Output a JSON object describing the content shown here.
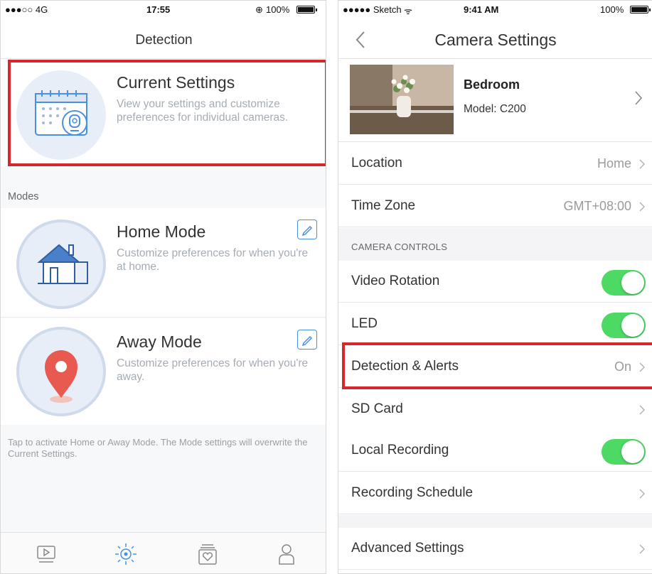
{
  "left": {
    "status": {
      "carrier": "●●●○○ 4G",
      "time": "17:55",
      "battery_label": "100%",
      "battery_level": 1.0
    },
    "title": "Detection",
    "current_settings": {
      "title": "Current Settings",
      "description": "View your settings and customize preferences for individual cameras."
    },
    "modes_label": "Modes",
    "home_mode": {
      "title": "Home Mode",
      "description": "Customize preferences for when you're at home."
    },
    "away_mode": {
      "title": "Away Mode",
      "description": "Customize preferences for when you're away."
    },
    "footer_note": "Tap to activate Home or Away Mode. The Mode settings will overwrite the Current Settings.",
    "tabs": [
      {
        "icon": "video-playback-icon"
      },
      {
        "icon": "detection-icon",
        "active": true
      },
      {
        "icon": "memories-icon"
      },
      {
        "icon": "profile-icon"
      }
    ],
    "colors": {
      "accent": "#4a90e2",
      "highlight": "#d7262c",
      "pin": "#e8594f"
    }
  },
  "right": {
    "status": {
      "carrier": "●●●●● Sketch",
      "time": "9:41 AM",
      "battery_label": "100%",
      "battery_level": 1.0
    },
    "title": "Camera Settings",
    "camera": {
      "name": "Bedroom",
      "model": "Model: C200"
    },
    "rows_top": [
      {
        "label": "Location",
        "value": "Home"
      },
      {
        "label": "Time Zone",
        "value": "GMT+08:00"
      }
    ],
    "section_label": "CAMERA CONTROLS",
    "controls": [
      {
        "label": "Video Rotation",
        "toggle": true
      },
      {
        "label": "LED",
        "toggle": true
      },
      {
        "label": "Detection & Alerts",
        "value": "On"
      },
      {
        "label": "SD Card",
        "value": ""
      },
      {
        "label": "Local Recording",
        "toggle": true
      },
      {
        "label": "Recording Schedule",
        "value": ""
      }
    ],
    "advanced": {
      "label": "Advanced Settings"
    },
    "colors": {
      "toggle_on": "#4cd964",
      "highlight": "#d7262c"
    }
  }
}
